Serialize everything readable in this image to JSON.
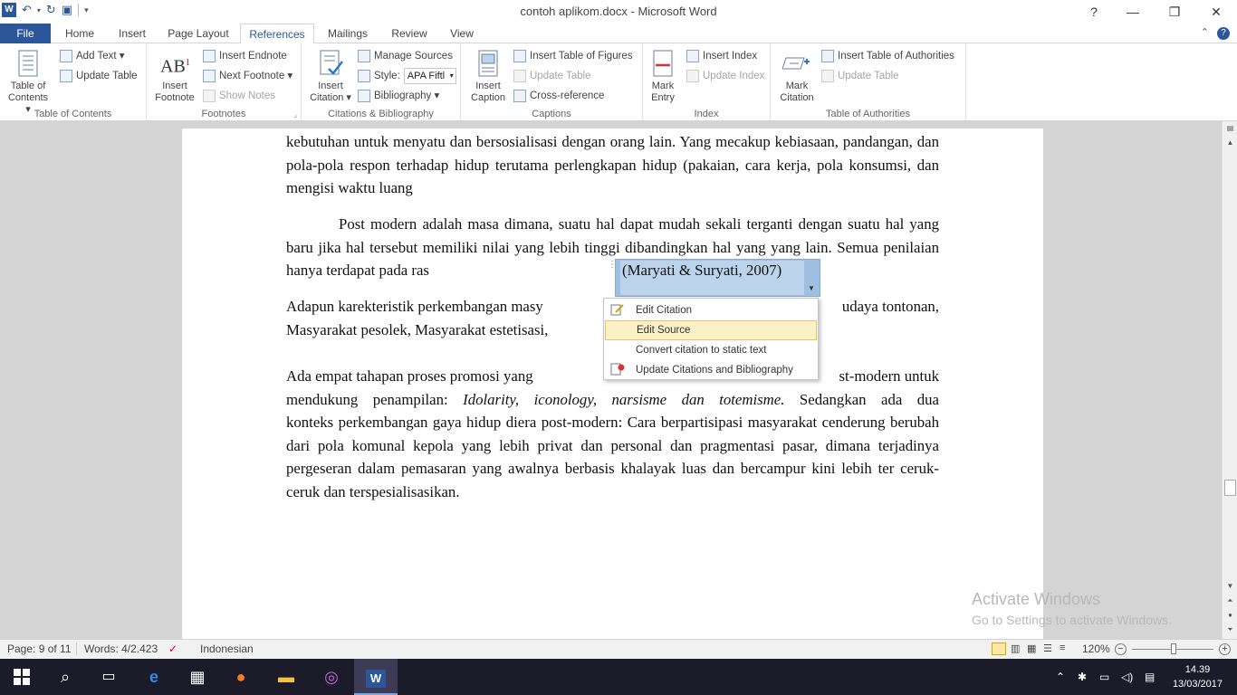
{
  "window": {
    "title": "contoh aplikom.docx - Microsoft Word",
    "app_icon": "W",
    "minimize": "—",
    "restore": "❐",
    "close": "✕"
  },
  "ribbon_tabs": [
    "File",
    "Home",
    "Insert",
    "Page Layout",
    "References",
    "Mailings",
    "Review",
    "View"
  ],
  "active_tab": "References",
  "ribbon": {
    "toc": {
      "table_of_contents": "Table of",
      "table_of_contents2": "Contents ▾",
      "add_text": "Add Text ▾",
      "update_table": "Update Table",
      "label": "Table of Contents"
    },
    "footnotes": {
      "insert_footnote": "Insert",
      "insert_footnote2": "Footnote",
      "insert_endnote": "Insert Endnote",
      "next_footnote": "Next Footnote ▾",
      "show_notes": "Show Notes",
      "label": "Footnotes"
    },
    "citations": {
      "insert_citation": "Insert",
      "insert_citation2": "Citation ▾",
      "manage_sources": "Manage Sources",
      "style_label": "Style:",
      "style_value": "APA Fiftl",
      "bibliography": "Bibliography ▾",
      "label": "Citations & Bibliography"
    },
    "captions": {
      "insert_caption": "Insert",
      "insert_caption2": "Caption",
      "insert_table_of_figures": "Insert Table of Figures",
      "update_table": "Update Table",
      "cross_reference": "Cross-reference",
      "label": "Captions"
    },
    "index": {
      "mark_entry": "Mark",
      "mark_entry2": "Entry",
      "insert_index": "Insert Index",
      "update_index": "Update Index",
      "label": "Index"
    },
    "authorities": {
      "mark_citation": "Mark",
      "mark_citation2": "Citation",
      "insert_toa": "Insert Table of Authorities",
      "update_table": "Update Table",
      "label": "Table of Authorities"
    }
  },
  "document": {
    "para1": "kebutuhan untuk menyatu dan bersosialisasi dengan orang lain.  Yang mecakup kebiasaan, pandangan, dan pola-pola respon terhadap hidup terutama perlengkapan hidup (pakaian, cara kerja, pola konsumsi, dan mengisi waktu luang",
    "para2": "Post modern adalah masa dimana, suatu hal dapat mudah sekali terganti dengan suatu hal yang baru jika hal tersebut memiliki nilai yang lebih tinggi dibandingkan hal yang yang lain. Semua penilaian hanya terdapat pada ras",
    "citation": "(Maryati & Suryati, 2007)",
    "para3_left": "Adapun karekteristik perkembangan masy",
    "para3_right": "udaya tontonan,",
    "para3_line2": "Masyarakat pesolek, Masyarakat estetisasi,",
    "para4_line1_left": "Ada empat tahapan proses promosi yang",
    "para4_line1_right": "st-modern untuk",
    "para4_line2_a": "mendukung penampilan: ",
    "para4_line2_italic": "Idolarity, iconology, narsisme dan totemisme.",
    "para4_line2_b": " Sedangkan ada dua",
    "para4_rest": "konteks perkembangan gaya hidup diera post-modern: Cara berpartisipasi masyarakat cenderung berubah dari pola komunal kepola yang lebih privat dan personal dan pragmentasi pasar, dimana terjadinya pergeseran dalam pemasaran yang awalnya berbasis khalayak luas dan bercampur kini lebih ter ceruk-ceruk dan terspesialisasikan."
  },
  "context_menu": {
    "items": [
      "Edit Citation",
      "Edit Source",
      "Convert citation to static text",
      "Update Citations and Bibliography"
    ],
    "highlighted": "Edit Source"
  },
  "watermark": {
    "line1": "Activate Windows",
    "line2": "Go to Settings to activate Windows."
  },
  "statusbar": {
    "page": "Page: 9 of 11",
    "words": "Words: 4/2.423",
    "language": "Indonesian",
    "zoom": "120%"
  },
  "taskbar": {
    "time": "14.39",
    "date": "13/03/2017"
  }
}
